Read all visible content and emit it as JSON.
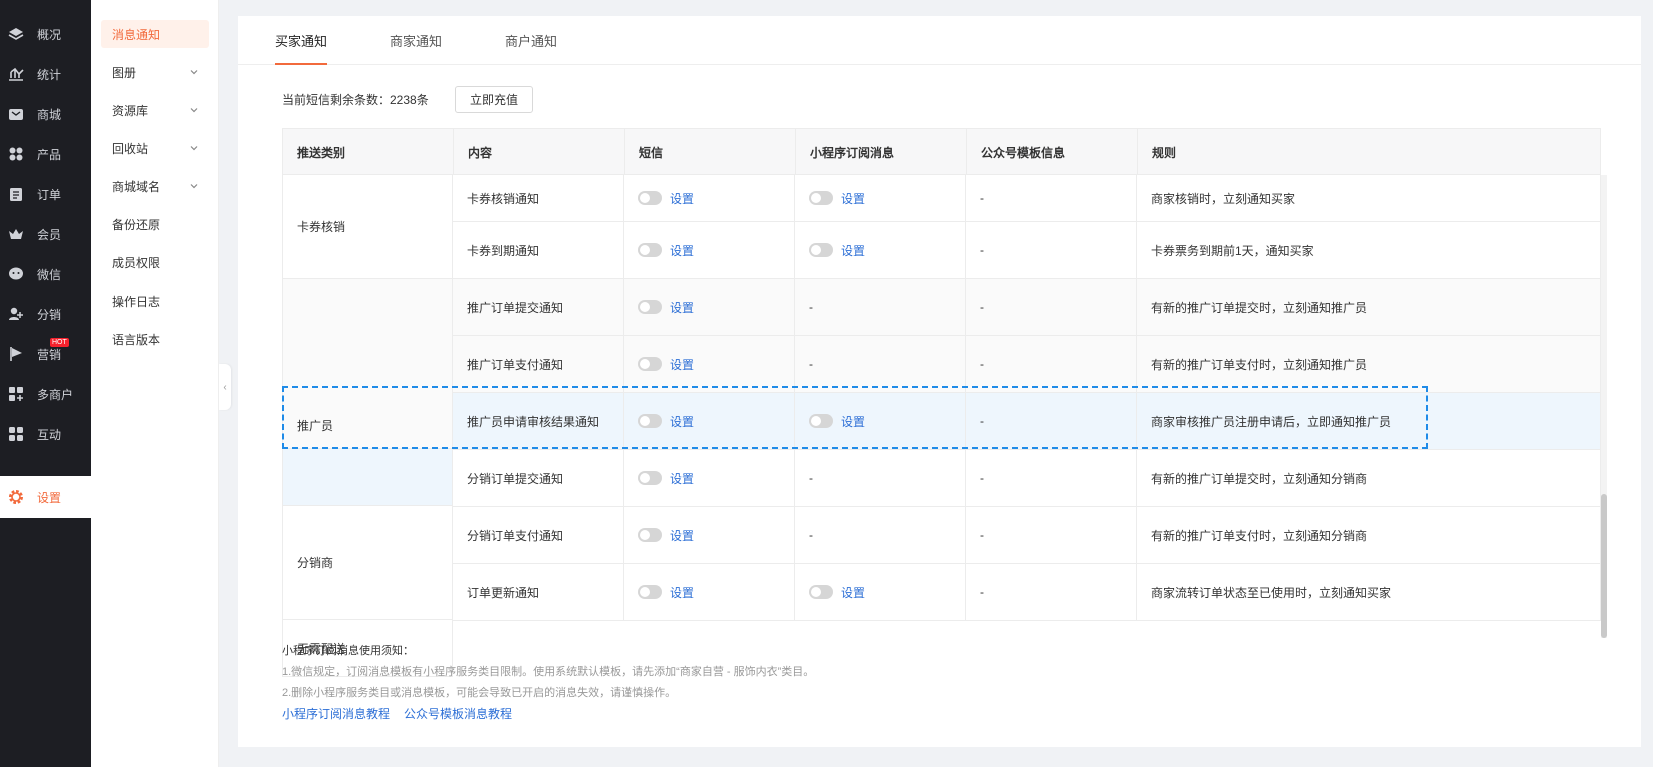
{
  "rail": {
    "items": [
      {
        "label": "概况",
        "icon": "layers-icon"
      },
      {
        "label": "统计",
        "icon": "chart-icon"
      },
      {
        "label": "商城",
        "icon": "mail-shop-icon"
      },
      {
        "label": "产品",
        "icon": "grid-icon"
      },
      {
        "label": "订单",
        "icon": "order-icon"
      },
      {
        "label": "会员",
        "icon": "crown-icon"
      },
      {
        "label": "微信",
        "icon": "wechat-icon"
      },
      {
        "label": "分销",
        "icon": "user-share-icon"
      },
      {
        "label": "营销",
        "icon": "flag-icon",
        "badge": "HOT"
      },
      {
        "label": "多商户",
        "icon": "store-add-icon"
      },
      {
        "label": "互动",
        "icon": "apps-icon"
      },
      {
        "label": "设置",
        "icon": "gear-icon",
        "active": true
      }
    ]
  },
  "subnav": {
    "items": [
      {
        "label": "消息通知",
        "active": true
      },
      {
        "label": "图册",
        "expandable": true
      },
      {
        "label": "资源库",
        "expandable": true
      },
      {
        "label": "回收站",
        "expandable": true
      },
      {
        "label": "商城域名",
        "expandable": true
      },
      {
        "label": "备份还原"
      },
      {
        "label": "成员权限"
      },
      {
        "label": "操作日志"
      },
      {
        "label": "语言版本"
      }
    ]
  },
  "tabs": [
    "买家通知",
    "商家通知",
    "商户通知"
  ],
  "sms": {
    "label": "当前短信剩余条数：2238条",
    "recharge": "立即充值"
  },
  "table": {
    "headers": [
      "推送类别",
      "内容",
      "短信",
      "小程序订阅消息",
      "公众号模板信息",
      "规则"
    ],
    "set_label": "设置",
    "groups": [
      "卡券核销",
      "推广员",
      "分销商",
      "无需配送"
    ],
    "rows": [
      {
        "content": "卡券核销通知",
        "sms": "设置",
        "mini": "设置",
        "mp": "-",
        "rule": "商家核销时，立刻通知买家"
      },
      {
        "content": "卡券到期通知",
        "sms": "设置",
        "mini": "设置",
        "mp": "-",
        "rule": "卡券票务到期前1天，通知买家"
      },
      {
        "content": "推广订单提交通知",
        "sms": "设置",
        "mini": "-",
        "mp": "-",
        "rule": "有新的推广订单提交时，立刻通知推广员"
      },
      {
        "content": "推广订单支付通知",
        "sms": "设置",
        "mini": "-",
        "mp": "-",
        "rule": "有新的推广订单支付时，立刻通知推广员"
      },
      {
        "content": "推广员申请审核结果通知",
        "sms": "设置",
        "mini": "设置",
        "mp": "-",
        "rule": "商家审核推广员注册申请后，立即通知推广员"
      },
      {
        "content": "分销订单提交通知",
        "sms": "设置",
        "mini": "-",
        "mp": "-",
        "rule": "有新的推广订单提交时，立刻通知分销商"
      },
      {
        "content": "分销订单支付通知",
        "sms": "设置",
        "mini": "-",
        "mp": "-",
        "rule": "有新的推广订单支付时，立刻通知分销商"
      },
      {
        "content": "订单更新通知",
        "sms": "设置",
        "mini": "设置",
        "mp": "-",
        "rule": "商家流转订单状态至已使用时，立刻通知买家"
      }
    ]
  },
  "notes": {
    "title": "小程序订阅消息使用须知：",
    "line1": "1.微信规定，订阅消息模板有小程序服务类目限制。使用系统默认模板，请先添加“商家自营 - 服饰内衣”类目。",
    "line2": "2.删除小程序服务类目或消息模板，可能会导致已开启的消息失效，请谨慎操作。",
    "link1": "小程序订阅消息教程",
    "link2": "公众号模板消息教程"
  },
  "colors": {
    "accent": "#f26a3c",
    "link": "#2d6fd6",
    "highlight": "#1f8be8",
    "rail": "#1d1e23"
  }
}
